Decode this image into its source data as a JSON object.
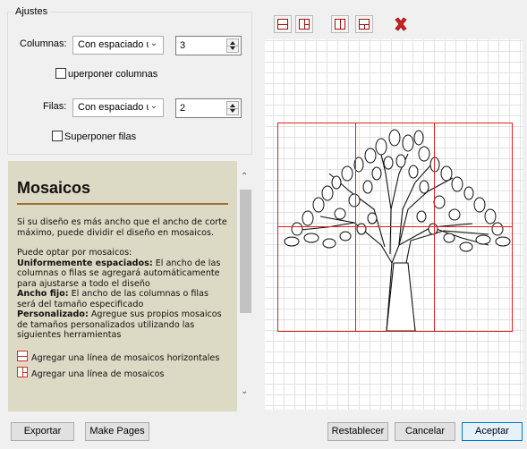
{
  "settings": {
    "title": "Ajustes",
    "columns": {
      "label": "Columnas:",
      "mode": "Con espaciado ur",
      "count": "3",
      "overlap_label": "uperponer columnas"
    },
    "rows": {
      "label": "Filas:",
      "mode": "Con espaciado ur",
      "count": "2",
      "overlap_label": "Superponer filas"
    }
  },
  "help": {
    "title": "Mosaicos",
    "intro": "Si su diseño es más ancho que el ancho de corte máximo, puede dividir el diseño en mosaicos.",
    "options_intro": "Puede optar por mosaicos:",
    "uniform_term": "Uniformemente espaciados:",
    "uniform_desc": " El ancho de las columnas o filas se agregará automáticamente para ajustarse a todo el diseño",
    "fixed_term": "Ancho fijo:",
    "fixed_desc": " El ancho de las columnas o filas será del tamaño especificado",
    "custom_term": "Personalizado:",
    "custom_desc": " Agregue sus propios mosaicos de tamaños personalizados utilizando las siguientes herramientas",
    "tool1": "Agregar una línea de mosaicos horizontales",
    "tool2": "Agregar una línea de mosaicos"
  },
  "toolbar": {
    "icons": [
      "add-horizontal-line-icon",
      "add-horizontal-segment-icon",
      "add-vertical-line-icon",
      "add-vertical-segment-icon",
      "delete-icon"
    ],
    "accent": "#d42020"
  },
  "buttons": {
    "export": "Exportar",
    "make_pages": "Make Pages",
    "reset": "Restablecer",
    "cancel": "Cancelar",
    "accept": "Aceptar"
  },
  "colors": {
    "tile_lines": "#e02020",
    "help_bg": "#dcd9c4",
    "help_rule": "#a07030"
  }
}
